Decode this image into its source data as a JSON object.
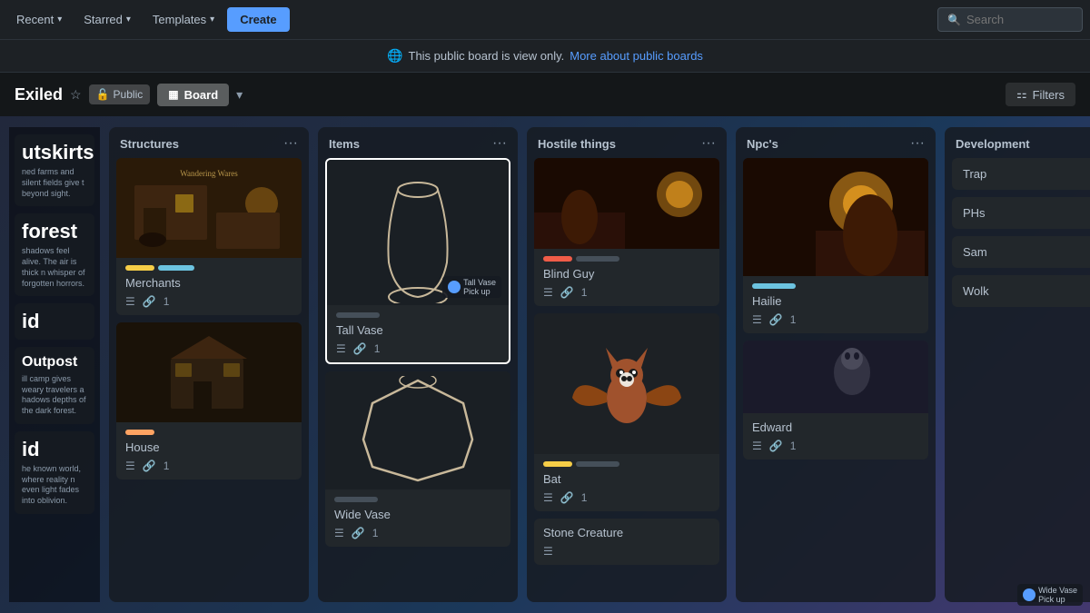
{
  "nav": {
    "recent_label": "Recent",
    "starred_label": "Starred",
    "templates_label": "Templates",
    "create_label": "Create",
    "search_placeholder": "Search"
  },
  "banner": {
    "icon": "🌐",
    "text": "This public board is view only.",
    "link_text": "More about public boards"
  },
  "board": {
    "title": "Exiled",
    "visibility": "Public",
    "view": "Board",
    "filters_label": "Filters"
  },
  "sidebar_items": [
    {
      "title": "utskirts",
      "text": "ned farms and silent fields give\nt beyond sight."
    },
    {
      "title": "forest",
      "text": "shadows feel alive. The air is thick\nn whisper of forgotten horrors."
    },
    {
      "title": "id",
      "text": ""
    },
    {
      "title": "Outpost",
      "text": "ill camp gives weary travelers a\nhadows depths of the dark forest."
    },
    {
      "title": "id",
      "text": "he known world, where reality\nn even light fades into oblivion."
    }
  ],
  "columns": [
    {
      "id": "structures",
      "title": "Structures",
      "cards": [
        {
          "id": "merchants",
          "title": "Merchants",
          "has_image": true,
          "image_type": "tavern",
          "labels": [
            "yellow",
            "cyan"
          ],
          "has_description": true,
          "attachment_count": 1
        },
        {
          "id": "house",
          "title": "House",
          "has_image": false,
          "labels": [
            "orange"
          ],
          "has_description": true,
          "attachment_count": 1
        }
      ]
    },
    {
      "id": "items",
      "title": "Items",
      "cards": [
        {
          "id": "tall-vase",
          "title": "Tall Vase",
          "has_image": true,
          "image_type": "tall-vase",
          "labels": [
            "gray"
          ],
          "selected": true,
          "has_description": true,
          "attachment_count": 1
        },
        {
          "id": "wide-vase",
          "title": "Wide Vase",
          "has_image": true,
          "image_type": "wide-vase",
          "labels": [
            "gray"
          ],
          "has_description": true,
          "attachment_count": 1
        }
      ]
    },
    {
      "id": "hostile-things",
      "title": "Hostile things",
      "cards": [
        {
          "id": "blind-guy",
          "title": "Blind Guy",
          "has_image": true,
          "image_type": "fire-scene",
          "labels": [
            "red",
            "gray"
          ],
          "has_description": true,
          "attachment_count": 1
        },
        {
          "id": "bat",
          "title": "Bat",
          "has_image": true,
          "image_type": "bat",
          "labels": [
            "yellow",
            "gray"
          ],
          "has_description": true,
          "attachment_count": 1
        },
        {
          "id": "stone-creature",
          "title": "Stone Creature",
          "has_image": false,
          "labels": [],
          "has_description": true,
          "attachment_count": 0
        }
      ]
    },
    {
      "id": "npcs",
      "title": "Npc's",
      "cards": [
        {
          "id": "hailie",
          "title": "Hailie",
          "has_image": true,
          "image_type": "fire-large",
          "labels": [
            "cyan"
          ],
          "has_description": true,
          "attachment_count": 1
        },
        {
          "id": "edward",
          "title": "Edward",
          "has_image": true,
          "image_type": "ghost",
          "labels": [],
          "has_description": true,
          "attachment_count": 1
        }
      ]
    },
    {
      "id": "development",
      "title": "Development",
      "cards": [
        {
          "id": "trap",
          "title": "Trap",
          "simple": true
        },
        {
          "id": "phs",
          "title": "PHs",
          "simple": true
        },
        {
          "id": "sam",
          "title": "Sam",
          "simple": true
        },
        {
          "id": "wolk",
          "title": "Wolk",
          "simple": true
        }
      ]
    }
  ]
}
